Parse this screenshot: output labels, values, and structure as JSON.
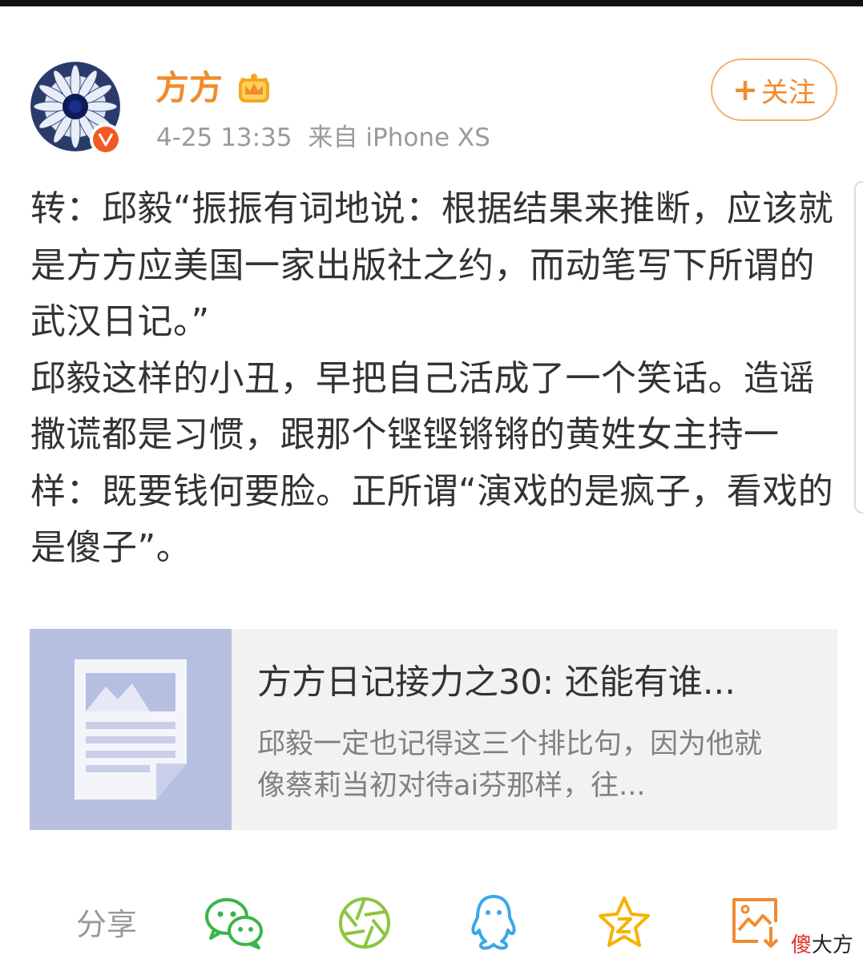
{
  "user": {
    "name": "方方",
    "timestamp": "4-25 13:35",
    "source": "来自 iPhone XS"
  },
  "follow_button": {
    "plus": "+",
    "label": "关注"
  },
  "post_text": "转：邱毅“振振有词地说：根据结果来推断，应该就是方方应美国一家出版社之约，而动笔写下所谓的武汉日记。”\n邱毅这样的小丑，早把自己活成了一个笑话。造谣撒谎都是习惯，跟那个铿铿锵锵的黄姓女主持一样：既要钱何要脸。正所谓“演戏的是疯子，看戏的是傻子”。",
  "link_card": {
    "title": "方方日记接力之30: 还能有谁...",
    "description": "邱毅一定也记得这三个排比句，因为他就像蔡莉当初对待ai芬那样，往..."
  },
  "share": {
    "label": "分享",
    "icons": [
      "wechat-icon",
      "moments-icon",
      "qq-icon",
      "qzone-icon",
      "save-image-icon"
    ]
  },
  "watermark": {
    "red_part": "傻",
    "black_part": "大方"
  },
  "colors": {
    "accent_orange": "#f08c2e",
    "wechat_green": "#3bb54a",
    "moments_green": "#8cc63f",
    "qq_blue": "#3aa8e6",
    "qzone_yellow": "#f5b400",
    "save_orange": "#f08c2e",
    "verified_badge": "#f15a22"
  }
}
